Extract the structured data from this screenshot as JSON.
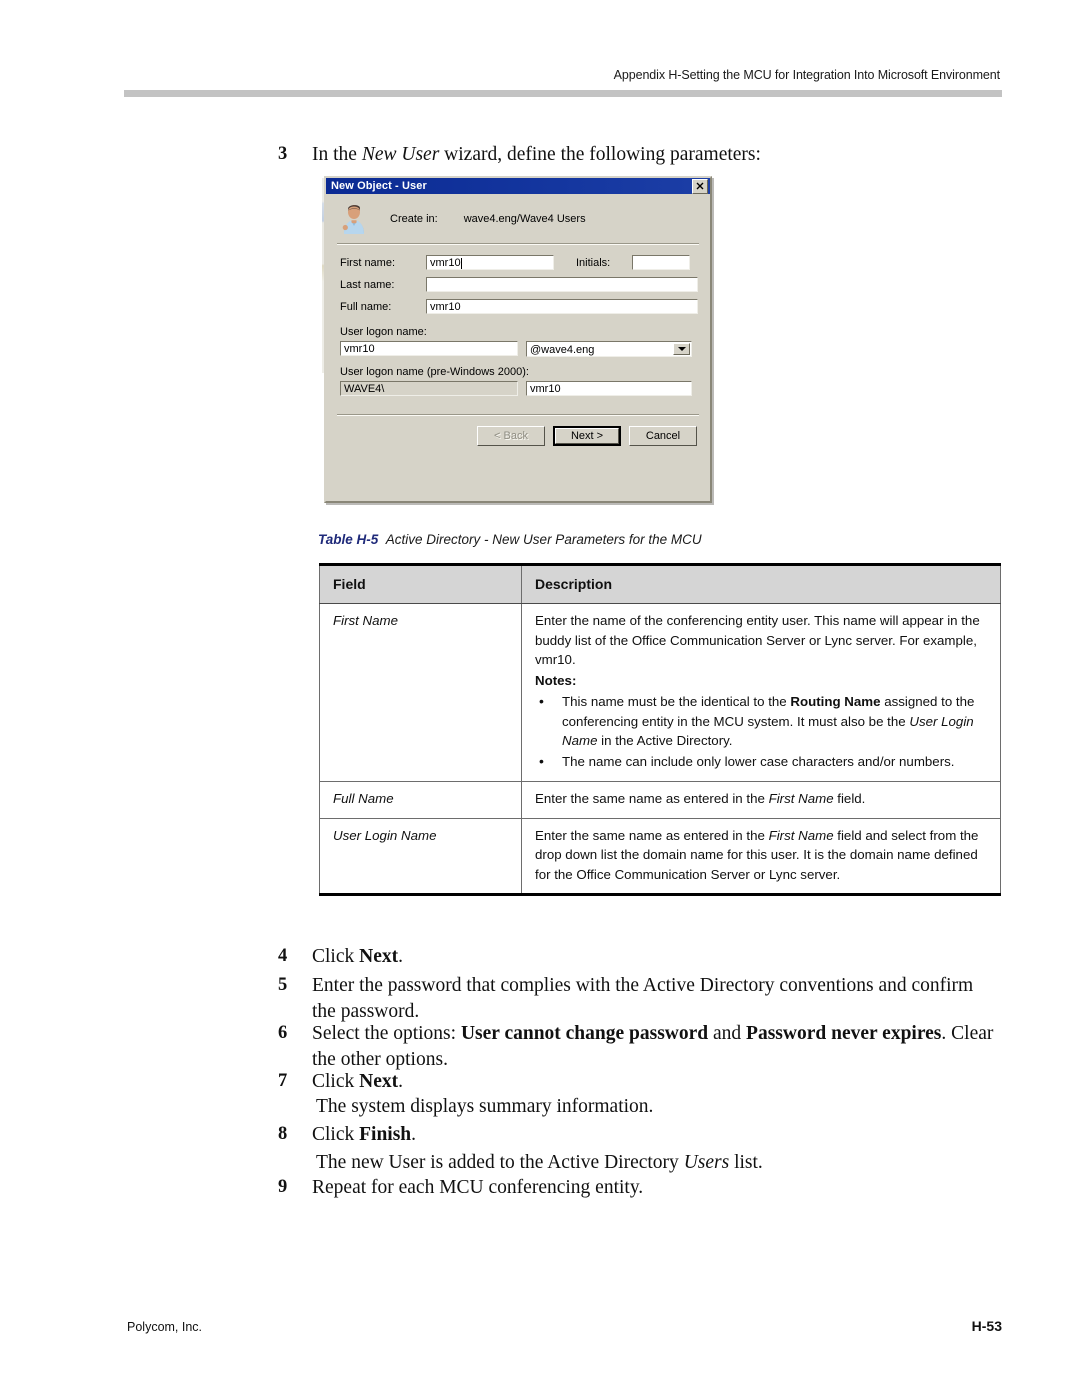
{
  "header": {
    "running_head": "Appendix H-Setting the MCU for Integration Into Microsoft Environment"
  },
  "steps": [
    {
      "num": "3",
      "text_parts": [
        {
          "t": "In the ",
          "style": "normal"
        },
        {
          "t": "New User",
          "style": "italic"
        },
        {
          "t": " wizard, define the following parameters:",
          "style": "normal"
        }
      ]
    },
    {
      "num": "4",
      "text_parts": [
        {
          "t": "Click ",
          "style": "normal"
        },
        {
          "t": "Next",
          "style": "bold"
        },
        {
          "t": ".",
          "style": "normal"
        }
      ]
    },
    {
      "num": "5",
      "text_parts": [
        {
          "t": "Enter the password that complies with the Active Directory conventions and confirm the password.",
          "style": "normal"
        }
      ]
    },
    {
      "num": "6",
      "text_parts": [
        {
          "t": "Select the options: ",
          "style": "normal"
        },
        {
          "t": "User cannot change password",
          "style": "bold"
        },
        {
          "t": " and ",
          "style": "normal"
        },
        {
          "t": "Password never expires",
          "style": "bold"
        },
        {
          "t": ". Clear the other options.",
          "style": "normal"
        }
      ]
    },
    {
      "num": "7",
      "text_parts": [
        {
          "t": "Click ",
          "style": "normal"
        },
        {
          "t": "Next",
          "style": "bold"
        },
        {
          "t": ".",
          "style": "normal"
        }
      ],
      "follow_up": "The system displays summary information."
    },
    {
      "num": "8",
      "text_parts": [
        {
          "t": "Click ",
          "style": "normal"
        },
        {
          "t": "Finish",
          "style": "bold"
        },
        {
          "t": ".",
          "style": "normal"
        }
      ],
      "follow_up_parts": [
        {
          "t": "The new User is added to the Active Directory ",
          "style": "normal"
        },
        {
          "t": "Users",
          "style": "italic"
        },
        {
          "t": " list.",
          "style": "normal"
        }
      ]
    },
    {
      "num": "9",
      "text_parts": [
        {
          "t": "Repeat for each MCU conferencing entity.",
          "style": "normal"
        }
      ]
    }
  ],
  "dialog": {
    "title": "New Object - User",
    "close_label": "✕",
    "create_in_label": "Create in:",
    "create_in_value": "wave4.eng/Wave4 Users",
    "fields": {
      "first_name_label": "First name:",
      "first_name_value": "vmr10",
      "initials_label": "Initials:",
      "initials_value": "",
      "last_name_label": "Last name:",
      "last_name_value": "",
      "full_name_label": "Full name:",
      "full_name_value": "vmr10",
      "logon_name_label": "User logon name:",
      "logon_name_value": "vmr10",
      "logon_domain_value": "@wave4.eng",
      "pre2000_label": "User logon name (pre-Windows 2000):",
      "pre2000_domain_value": "WAVE4\\",
      "pre2000_name_value": "vmr10"
    },
    "buttons": {
      "back": "< Back",
      "next": "Next >",
      "cancel": "Cancel"
    }
  },
  "table": {
    "caption_label": "Table H-5",
    "caption_text": "Active Directory - New User Parameters for the MCU",
    "caption_color": "#1f2a7a",
    "headers": [
      "Field",
      "Description"
    ],
    "rows": [
      {
        "field": "First Name",
        "description_paragraphs": [
          [
            {
              "t": "Enter the name of the conferencing entity user. This name will appear in the buddy list of the Office Communication Server or Lync server. For example, vmr10.",
              "style": "normal"
            }
          ]
        ],
        "notes_label": "Notes:",
        "notes": [
          [
            {
              "t": "This name must be the identical to the ",
              "style": "normal"
            },
            {
              "t": "Routing Name",
              "style": "bold"
            },
            {
              "t": " assigned to the conferencing entity in the MCU system. It must also be the ",
              "style": "normal"
            },
            {
              "t": "User Login Name",
              "style": "italic"
            },
            {
              "t": " in the Active Directory.",
              "style": "normal"
            }
          ],
          [
            {
              "t": "The name can include only lower case characters and/or numbers.",
              "style": "normal"
            }
          ]
        ]
      },
      {
        "field": "Full Name",
        "description_paragraphs": [
          [
            {
              "t": "Enter the same name as entered in the ",
              "style": "normal"
            },
            {
              "t": "First Name",
              "style": "italic"
            },
            {
              "t": " field.",
              "style": "normal"
            }
          ]
        ],
        "notes_label": "",
        "notes": []
      },
      {
        "field": "User Login Name",
        "description_paragraphs": [
          [
            {
              "t": "Enter the same name as entered in the ",
              "style": "normal"
            },
            {
              "t": "First Name",
              "style": "italic"
            },
            {
              "t": " field and select from the drop down list the domain name for this user. It is the domain name defined for the Office Communication Server or Lync server.",
              "style": "normal"
            }
          ]
        ],
        "notes_label": "",
        "notes": []
      }
    ]
  },
  "footer": {
    "left": "Polycom, Inc.",
    "right": "H-53"
  }
}
